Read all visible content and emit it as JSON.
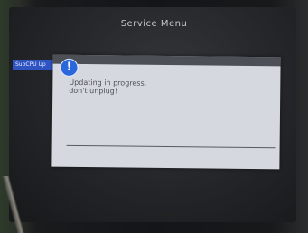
{
  "screen": {
    "title": "Service Menu"
  },
  "sidebar": {
    "selected_item": "SubCPU Up"
  },
  "dialog": {
    "icon": "info-icon",
    "message_line1": "Updating in progress,",
    "message_line2": "don't unplug!",
    "progress": 0
  },
  "colors": {
    "accent": "#2f54c2",
    "dialog_bg": "#d5d8de",
    "icon_blue": "#2a67dc"
  }
}
